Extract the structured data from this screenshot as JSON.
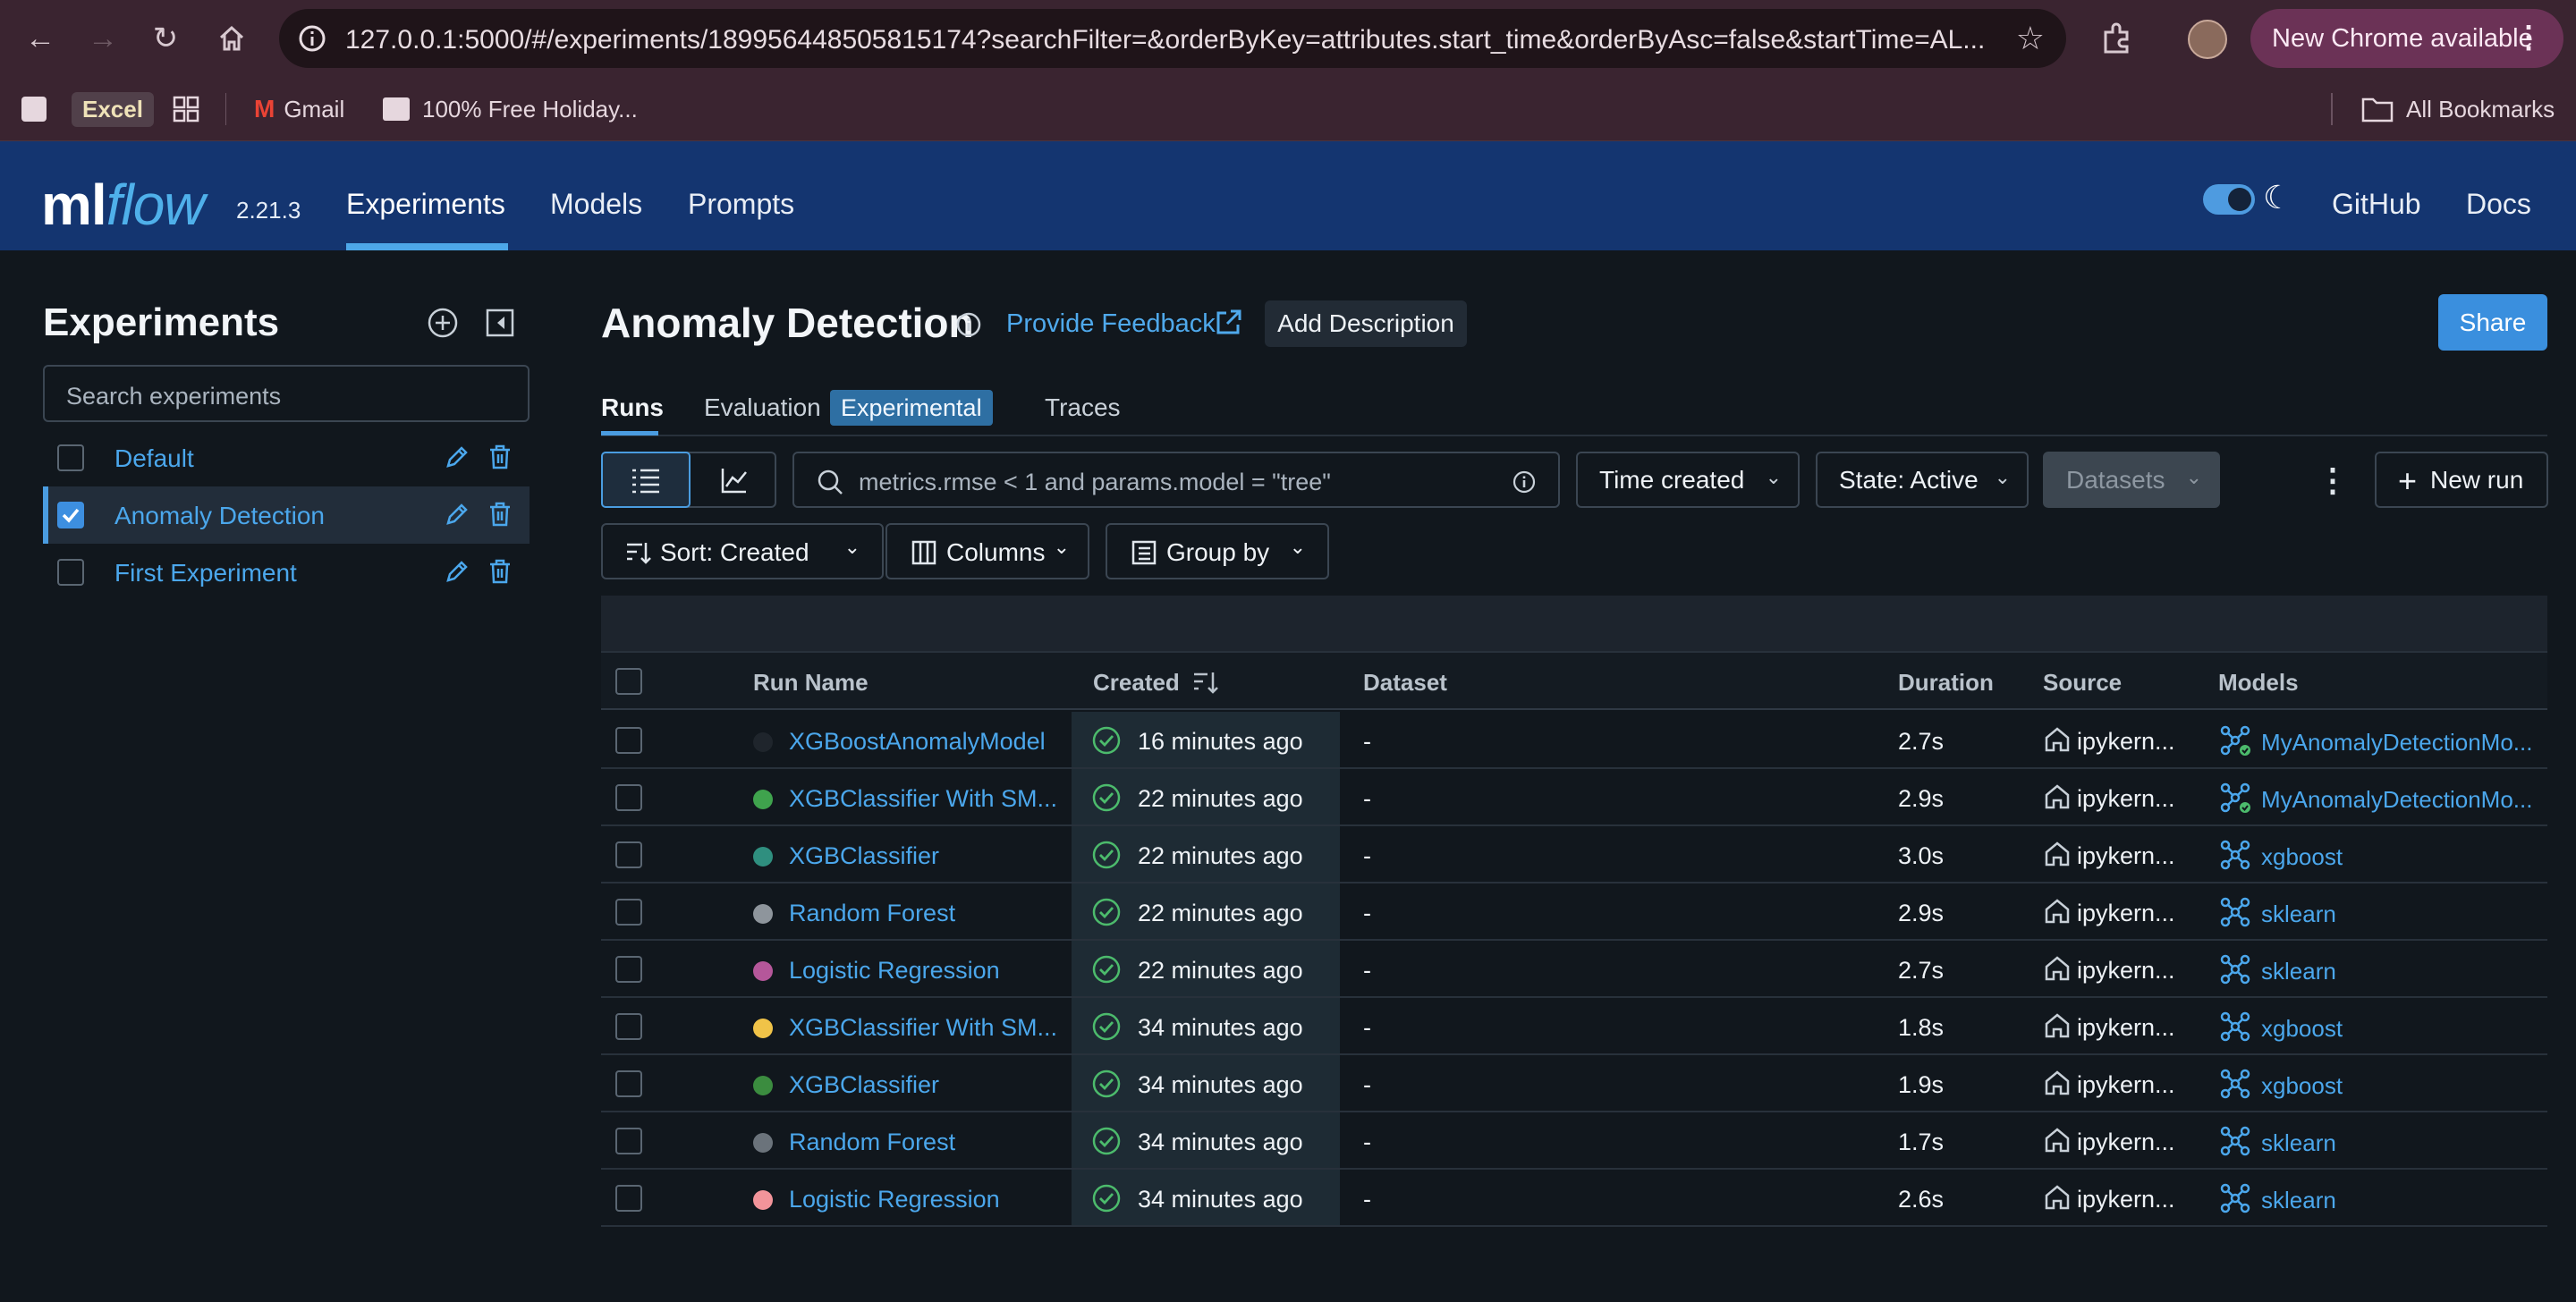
{
  "browser": {
    "url": "127.0.0.1:5000/#/experiments/189956448505815174?searchFilter=&orderByKey=attributes.start_time&orderByAsc=false&startTime=AL...",
    "new_chrome_label": "New Chrome available",
    "bookmarks": [
      {
        "label": "Excel"
      },
      {
        "label": "Gmail"
      },
      {
        "label": "100% Free Holiday..."
      },
      {
        "label": "All Bookmarks"
      }
    ]
  },
  "header": {
    "logo_ml": "ml",
    "logo_flow": "flow",
    "version": "2.21.3",
    "nav": [
      "Experiments",
      "Models",
      "Prompts"
    ],
    "right_links": [
      "GitHub",
      "Docs"
    ]
  },
  "sidebar": {
    "title": "Experiments",
    "search_placeholder": "Search experiments",
    "experiments": [
      {
        "name": "Default",
        "selected": false
      },
      {
        "name": "Anomaly Detection",
        "selected": true
      },
      {
        "name": "First Experiment",
        "selected": false
      }
    ]
  },
  "main": {
    "title": "Anomaly Detection",
    "feedback_label": "Provide Feedback",
    "add_description_label": "Add Description",
    "share_label": "Share",
    "tabs": [
      "Runs",
      "Evaluation",
      "Traces"
    ],
    "experimental_badge": "Experimental",
    "filter_placeholder": "metrics.rmse < 1 and params.model = \"tree\"",
    "time_created_label": "Time created",
    "state_label": "State: Active",
    "datasets_label": "Datasets",
    "new_run_label": "New run",
    "sort_label": "Sort: Created",
    "columns_label": "Columns",
    "group_by_label": "Group by"
  },
  "table": {
    "headers": [
      "Run Name",
      "Created",
      "Dataset",
      "Duration",
      "Source",
      "Models"
    ],
    "rows": [
      {
        "name": "XGBoostAnomalyModel",
        "dot_color": "#1f252c",
        "created": "16 minutes ago",
        "dataset": "-",
        "duration": "2.7s",
        "source": "ipykern...",
        "model": "MyAnomalyDetectionMo...",
        "registered": true
      },
      {
        "name": "XGBClassifier With SM...",
        "dot_color": "#3fa34d",
        "created": "22 minutes ago",
        "dataset": "-",
        "duration": "2.9s",
        "source": "ipykern...",
        "model": "MyAnomalyDetectionMo...",
        "registered": true
      },
      {
        "name": "XGBClassifier",
        "dot_color": "#2f8f7f",
        "created": "22 minutes ago",
        "dataset": "-",
        "duration": "3.0s",
        "source": "ipykern...",
        "model": "xgboost",
        "registered": false
      },
      {
        "name": "Random Forest",
        "dot_color": "#8e959c",
        "created": "22 minutes ago",
        "dataset": "-",
        "duration": "2.9s",
        "source": "ipykern...",
        "model": "sklearn",
        "registered": false
      },
      {
        "name": "Logistic Regression",
        "dot_color": "#b5579a",
        "created": "22 minutes ago",
        "dataset": "-",
        "duration": "2.7s",
        "source": "ipykern...",
        "model": "sklearn",
        "registered": false
      },
      {
        "name": "XGBClassifier With SM...",
        "dot_color": "#f0c348",
        "created": "34 minutes ago",
        "dataset": "-",
        "duration": "1.8s",
        "source": "ipykern...",
        "model": "xgboost",
        "registered": false
      },
      {
        "name": "XGBClassifier",
        "dot_color": "#3b8c3f",
        "created": "34 minutes ago",
        "dataset": "-",
        "duration": "1.9s",
        "source": "ipykern...",
        "model": "xgboost",
        "registered": false
      },
      {
        "name": "Random Forest",
        "dot_color": "#6b737b",
        "created": "34 minutes ago",
        "dataset": "-",
        "duration": "1.7s",
        "source": "ipykern...",
        "model": "sklearn",
        "registered": false
      },
      {
        "name": "Logistic Regression",
        "dot_color": "#f2949a",
        "created": "34 minutes ago",
        "dataset": "-",
        "duration": "2.6s",
        "source": "ipykern...",
        "model": "sklearn",
        "registered": false
      }
    ]
  },
  "colors": {
    "header_bg": "#143570",
    "accent": "#4ba7ec",
    "success": "#4cbb6c"
  }
}
